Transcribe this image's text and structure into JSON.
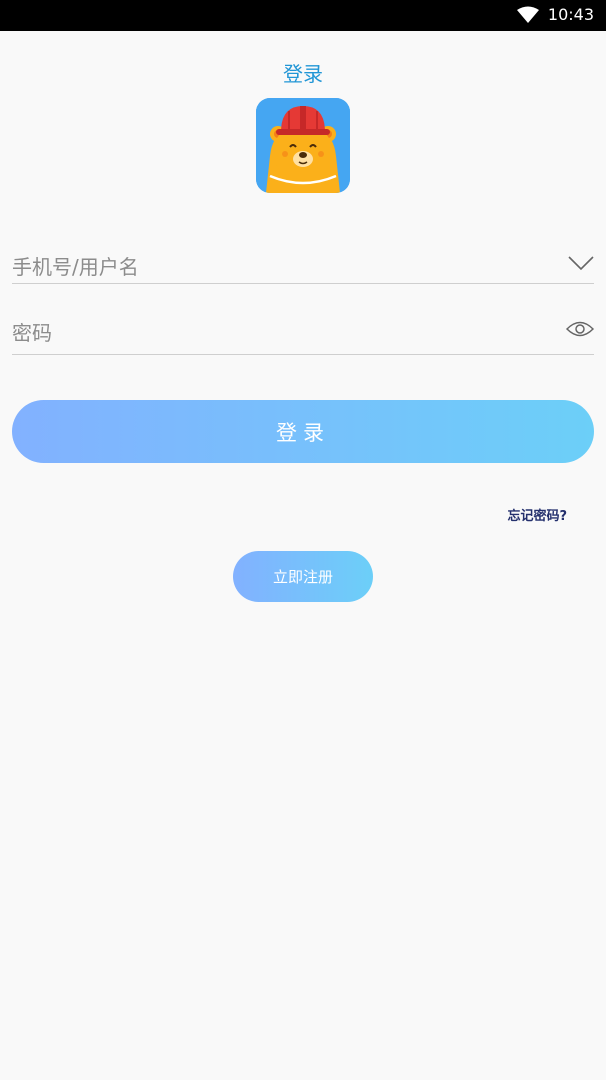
{
  "status_bar": {
    "time": "10:43",
    "icons": [
      "wifi-icon"
    ]
  },
  "page": {
    "title": "登录"
  },
  "logo": {
    "icon": "bear-with-hardhat-icon",
    "colors": {
      "background": "#45a6f2",
      "bear": "#fbb01a",
      "hardhat": "#e53935"
    }
  },
  "form": {
    "username_placeholder": "手机号/用户名",
    "username_dropdown_icon": "chevron-down-icon",
    "password_placeholder": "密码",
    "password_visibility_icon": "eye-icon"
  },
  "actions": {
    "login_label": "登录",
    "forgot_label": "忘记密码?",
    "register_label": "立即注册"
  },
  "colors": {
    "accent_title": "#2196d6",
    "button_gradient_start": "#82b1ff",
    "button_gradient_end": "#6ccff8",
    "forgot_link": "#24306d"
  }
}
